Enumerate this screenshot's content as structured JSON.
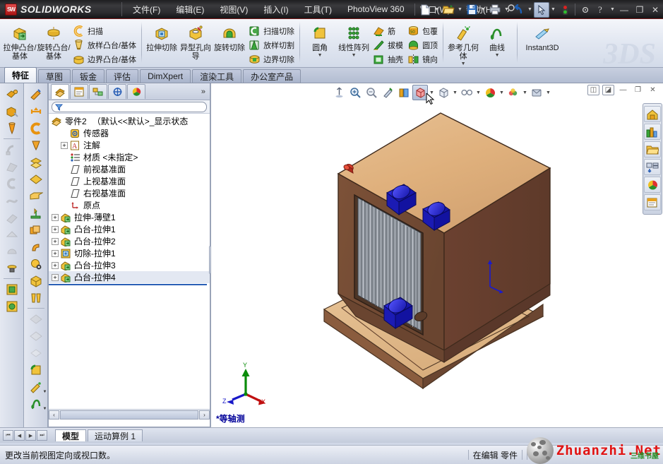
{
  "app": {
    "brand": "SOLIDWORKS",
    "brand_mark": "SW"
  },
  "menubar": {
    "items": [
      {
        "label": "文件(F)",
        "name": "menu-file"
      },
      {
        "label": "编辑(E)",
        "name": "menu-edit"
      },
      {
        "label": "视图(V)",
        "name": "menu-view"
      },
      {
        "label": "插入(I)",
        "name": "menu-insert"
      },
      {
        "label": "工具(T)",
        "name": "menu-tools"
      },
      {
        "label": "PhotoView 360",
        "name": "menu-photoview"
      },
      {
        "label": "窗口(W)",
        "name": "menu-window"
      },
      {
        "label": "帮助(H)",
        "name": "menu-help"
      }
    ],
    "pin_icon": "pin-icon",
    "quick_access": [
      {
        "name": "new-document-icon",
        "caret": true
      },
      {
        "name": "open-document-icon",
        "caret": true
      },
      {
        "name": "save-icon",
        "caret": true
      },
      {
        "name": "print-icon",
        "caret": true
      },
      {
        "name": "undo-icon",
        "caret": true
      },
      {
        "name": "select-tool-icon",
        "caret": true
      },
      {
        "name": "rebuild-icon",
        "caret": false
      },
      {
        "name": "options-icon",
        "caret": false
      },
      {
        "name": "help-icon",
        "caret": true
      }
    ],
    "window_buttons": [
      {
        "name": "minimize-button",
        "glyph": "—"
      },
      {
        "name": "restore-button",
        "glyph": "❐"
      },
      {
        "name": "close-button",
        "glyph": "✕"
      }
    ]
  },
  "ribbon": {
    "groups": [
      {
        "name": "boss-base-group",
        "big": [
          {
            "label": "拉伸凸台/基体",
            "icon": "extruded-boss-icon",
            "caret": false
          },
          {
            "label": "旋转凸台/基体",
            "icon": "revolved-boss-icon",
            "caret": false
          }
        ],
        "small": [
          {
            "label": "扫描",
            "icon": "swept-boss-icon"
          },
          {
            "label": "放样凸台/基体",
            "icon": "lofted-boss-icon"
          },
          {
            "label": "边界凸台/基体",
            "icon": "boundary-boss-icon"
          }
        ]
      },
      {
        "name": "cut-group",
        "big": [
          {
            "label": "拉伸切除",
            "icon": "extruded-cut-icon",
            "caret": false
          },
          {
            "label": "异型孔向导",
            "icon": "hole-wizard-icon",
            "caret": false
          },
          {
            "label": "旋转切除",
            "icon": "revolved-cut-icon",
            "caret": false
          }
        ],
        "small": [
          {
            "label": "扫描切除",
            "icon": "swept-cut-icon"
          },
          {
            "label": "放样切割",
            "icon": "lofted-cut-icon"
          },
          {
            "label": "边界切除",
            "icon": "boundary-cut-icon"
          }
        ]
      },
      {
        "name": "feature-group",
        "big": [
          {
            "label": "圆角",
            "icon": "fillet-icon",
            "caret": true
          },
          {
            "label": "线性阵列",
            "icon": "linear-pattern-icon",
            "caret": true
          }
        ],
        "small": [
          {
            "label": "筋",
            "icon": "rib-icon"
          },
          {
            "label": "拔模",
            "icon": "draft-icon"
          },
          {
            "label": "抽壳",
            "icon": "shell-icon"
          }
        ],
        "small2": [
          {
            "label": "包覆",
            "icon": "wrap-icon"
          },
          {
            "label": "圆顶",
            "icon": "dome-icon"
          },
          {
            "label": "镜向",
            "icon": "mirror-icon"
          }
        ]
      },
      {
        "name": "reference-group",
        "big": [
          {
            "label": "参考几何体",
            "icon": "reference-geometry-icon",
            "caret": true
          },
          {
            "label": "曲线",
            "icon": "curves-icon",
            "caret": true
          }
        ]
      },
      {
        "name": "instant3d-group",
        "big": [
          {
            "label": "Instant3D",
            "icon": "instant3d-icon",
            "caret": false
          }
        ]
      }
    ],
    "ds_logo": "3DS"
  },
  "tabs": {
    "items": [
      {
        "label": "特征",
        "name": "tab-features",
        "active": true
      },
      {
        "label": "草图",
        "name": "tab-sketch",
        "active": false
      },
      {
        "label": "钣金",
        "name": "tab-sheetmetal",
        "active": false
      },
      {
        "label": "评估",
        "name": "tab-evaluate",
        "active": false
      },
      {
        "label": "DimXpert",
        "name": "tab-dimxpert",
        "active": false
      },
      {
        "label": "渲染工具",
        "name": "tab-render-tools",
        "active": false
      },
      {
        "label": "办公室产品",
        "name": "tab-office-products",
        "active": false
      }
    ]
  },
  "tree_panel": {
    "tabs": [
      {
        "name": "feature-manager-tab",
        "selected": true
      },
      {
        "name": "property-manager-tab",
        "selected": false
      },
      {
        "name": "configuration-manager-tab",
        "selected": false
      },
      {
        "name": "dimxpert-manager-tab",
        "selected": false
      },
      {
        "name": "display-manager-tab",
        "selected": false
      }
    ],
    "chevron": "»",
    "filter_placeholder": "",
    "root": {
      "label": "零件2",
      "state": "（默认<<默认>_显示状态",
      "icon": "part-icon"
    },
    "nodes": [
      {
        "label": "传感器",
        "icon": "sensors-icon",
        "expandable": false,
        "indent": 1
      },
      {
        "label": "注解",
        "icon": "annotations-icon",
        "expandable": true,
        "indent": 1
      },
      {
        "label": "材质 <未指定>",
        "icon": "material-icon",
        "expandable": false,
        "indent": 1
      },
      {
        "label": "前视基准面",
        "icon": "plane-icon",
        "expandable": false,
        "indent": 1
      },
      {
        "label": "上视基准面",
        "icon": "plane-icon",
        "expandable": false,
        "indent": 1
      },
      {
        "label": "右视基准面",
        "icon": "plane-icon",
        "expandable": false,
        "indent": 1
      },
      {
        "label": "原点",
        "icon": "origin-icon",
        "expandable": false,
        "indent": 1
      },
      {
        "label": "拉伸-薄壁1",
        "icon": "extrude-feature-icon",
        "expandable": true,
        "indent": 0
      },
      {
        "label": "凸台-拉伸1",
        "icon": "extrude-feature-icon",
        "expandable": true,
        "indent": 0
      },
      {
        "label": "凸台-拉伸2",
        "icon": "extrude-feature-icon",
        "expandable": true,
        "indent": 0
      },
      {
        "label": "切除-拉伸1",
        "icon": "cut-feature-icon",
        "expandable": true,
        "indent": 0
      },
      {
        "label": "凸台-拉伸3",
        "icon": "extrude-feature-icon",
        "expandable": true,
        "indent": 0
      },
      {
        "label": "凸台-拉伸4",
        "icon": "extrude-feature-icon",
        "expandable": true,
        "indent": 0
      }
    ]
  },
  "view_toolbar": {
    "buttons": [
      {
        "name": "zoom-to-fit-icon",
        "caret": false,
        "pressed": false
      },
      {
        "name": "zoom-to-area-icon",
        "caret": false,
        "pressed": false
      },
      {
        "name": "previous-view-icon",
        "caret": false,
        "pressed": false
      },
      {
        "name": "section-view-icon",
        "caret": false,
        "pressed": false
      },
      {
        "name": "view-orientation-icon",
        "caret": false,
        "pressed": false
      },
      {
        "name": "display-style-icon",
        "caret": true,
        "pressed": true
      },
      {
        "name": "hide-show-items-icon",
        "caret": true,
        "pressed": false
      },
      {
        "name": "edit-appearance-icon",
        "caret": true,
        "pressed": false
      },
      {
        "name": "apply-scene-icon",
        "caret": true,
        "pressed": false
      },
      {
        "name": "view-settings-icon",
        "caret": true,
        "pressed": false
      }
    ],
    "window_controls": [
      {
        "name": "tile-horizontally-button",
        "glyph": "◫"
      },
      {
        "name": "tile-vertically-button",
        "glyph": "◪"
      },
      {
        "name": "minimize-window-button",
        "glyph": "—"
      },
      {
        "name": "restore-window-button",
        "glyph": "❐"
      },
      {
        "name": "close-window-button",
        "glyph": "✕"
      }
    ]
  },
  "task_pane": {
    "buttons": [
      {
        "name": "solidworks-resources-icon"
      },
      {
        "name": "design-library-icon"
      },
      {
        "name": "file-explorer-icon"
      },
      {
        "name": "view-palette-icon"
      },
      {
        "name": "appearances-scenes-icon"
      },
      {
        "name": "custom-properties-icon"
      }
    ]
  },
  "graphics": {
    "view_label": "*等轴测",
    "triad": {
      "x": "X",
      "y": "Y",
      "z": "Z"
    },
    "model_name": "radiator-assembly-3d-model"
  },
  "bottom_bar": {
    "pager": [
      "⏮",
      "◀",
      "▶",
      "⏭"
    ],
    "tabs": [
      {
        "label": "模型",
        "name": "tab-model",
        "active": true
      },
      {
        "label": "运动算例 1",
        "name": "tab-motion-study-1",
        "active": false
      }
    ],
    "hscroll": {
      "left_arrow": "‹",
      "right_arrow": "›"
    }
  },
  "status_bar": {
    "message": "更改当前视图定向或视口数。",
    "edit_state": "在编辑  零件"
  },
  "watermark": {
    "text": "Zhuanzhi.Net",
    "sub": "三维书屋"
  },
  "colors": {
    "accent": "#b01818",
    "titlebar": "#2b2b2e",
    "panel": "#d6dced",
    "graphics_bg": "#ffffff",
    "model_wood_light": "#e2b685",
    "model_wood_dark": "#7b4f36",
    "model_knob_blue": "#1414c8",
    "view_label": "#000099"
  }
}
